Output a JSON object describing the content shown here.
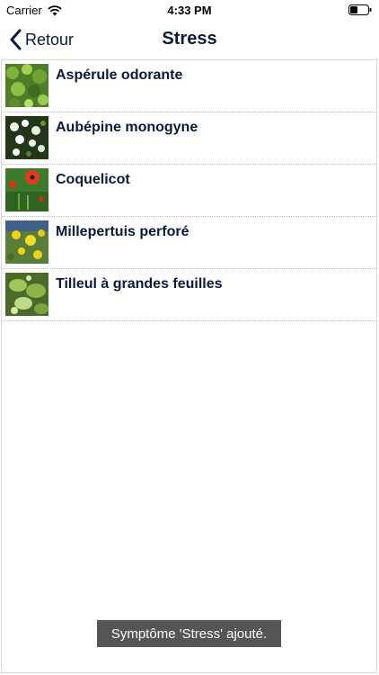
{
  "status_bar": {
    "carrier": "Carrier",
    "time": "4:33 PM",
    "wifi_icon": "wifi-icon",
    "battery_icon": "battery-icon"
  },
  "nav": {
    "back_label": "Retour",
    "title": "Stress"
  },
  "plants": [
    {
      "name": "Aspérule odorante",
      "thumb_icon": "plant-photo"
    },
    {
      "name": "Aubépine monogyne",
      "thumb_icon": "plant-photo"
    },
    {
      "name": "Coquelicot",
      "thumb_icon": "plant-photo"
    },
    {
      "name": "Millepertuis perforé",
      "thumb_icon": "plant-photo"
    },
    {
      "name": "Tilleul à grandes feuilles",
      "thumb_icon": "plant-photo"
    }
  ],
  "toast": {
    "message": "Symptôme 'Stress' ajouté."
  },
  "colors": {
    "text_dark": "#0b1a3a",
    "toast_bg": "#555555"
  }
}
